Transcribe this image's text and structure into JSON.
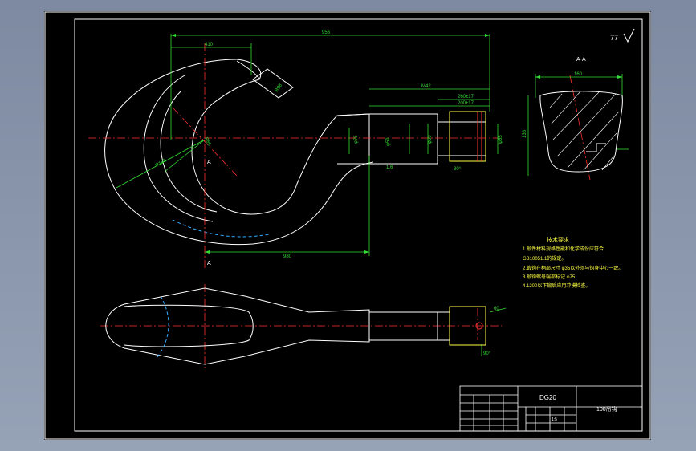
{
  "drawing": {
    "roughness_symbol": "77",
    "section_label": "A-A",
    "section_marks": [
      "A",
      "A"
    ],
    "title": "DG20",
    "name": "100吊钩",
    "scale": "1:5"
  },
  "tech_requirements": {
    "heading": "技术要求",
    "lines": [
      "1.锻件材料规格性能和化学成份应符合",
      "GB10051.1的规定。",
      "2.锻钩在柄部尺寸 φ35以外须与钩身中心一致。",
      "3.锻钩螺母端部标记 φ75",
      "4.1200以下锻后应用冲模检查。"
    ]
  },
  "dimensions": {
    "top_overall": "956",
    "top_left": "410",
    "shank_1": "M42",
    "shank_2": "260±17",
    "shank_3": "200±17",
    "hook_radius_1": "R98",
    "hook_radius_2": "R85",
    "hook_radius_3": "R188",
    "bottom_length": "980",
    "dia_1": "φ75",
    "dia_2": "φ59",
    "dia_3": "φ60",
    "dia_4": "φ55",
    "section_width": "160",
    "section_height": "136",
    "angle": "30°",
    "small_1": "1.6",
    "small_2": "60",
    "small_3": "90°"
  },
  "colors": {
    "line": "#ffffff",
    "dimension": "#33dd33",
    "center": "#ff3030",
    "hidden": "#33aaff",
    "text_yellow": "#ffff44",
    "frame": "#ffffff"
  }
}
